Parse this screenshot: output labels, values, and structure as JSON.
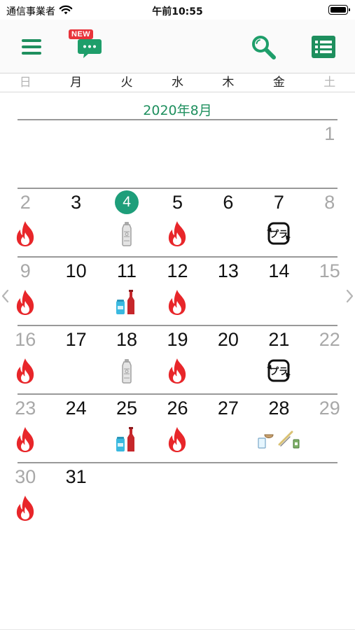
{
  "status_bar": {
    "carrier": "通信事業者",
    "time": "午前10:55"
  },
  "toolbar": {
    "menu_icon": "hamburger-menu-icon",
    "news_badge": "NEW",
    "news_icon": "chat-bubble-icon",
    "search_icon": "search-icon",
    "list_icon": "list-icon",
    "accent_color": "#1e8f5e"
  },
  "weekdays": [
    "日",
    "月",
    "火",
    "水",
    "木",
    "金",
    "土"
  ],
  "month_title": "2020年8月",
  "today": 4,
  "garbage_types": {
    "burnable": "flame-icon",
    "pet_bottle": "pet-bottle-icon",
    "cans_bottles": "can-and-bottle-icon",
    "plastic": "plastic-recycle-icon",
    "small_items": "misc-items-icon"
  },
  "weeks": [
    [
      null,
      null,
      null,
      null,
      null,
      null,
      {
        "day": "1",
        "g": []
      }
    ],
    [
      {
        "day": "2",
        "g": [
          "burnable"
        ]
      },
      {
        "day": "3",
        "g": []
      },
      {
        "day": "4",
        "g": [
          "pet_bottle"
        ]
      },
      {
        "day": "5",
        "g": [
          "burnable"
        ]
      },
      {
        "day": "6",
        "g": []
      },
      {
        "day": "7",
        "g": [
          "plastic"
        ]
      },
      {
        "day": "8",
        "g": []
      }
    ],
    [
      {
        "day": "9",
        "g": [
          "burnable"
        ]
      },
      {
        "day": "10",
        "g": []
      },
      {
        "day": "11",
        "g": [
          "cans_bottles"
        ]
      },
      {
        "day": "12",
        "g": [
          "burnable"
        ]
      },
      {
        "day": "13",
        "g": []
      },
      {
        "day": "14",
        "g": []
      },
      {
        "day": "15",
        "g": []
      }
    ],
    [
      {
        "day": "16",
        "g": [
          "burnable"
        ]
      },
      {
        "day": "17",
        "g": []
      },
      {
        "day": "18",
        "g": [
          "pet_bottle"
        ]
      },
      {
        "day": "19",
        "g": [
          "burnable"
        ]
      },
      {
        "day": "20",
        "g": []
      },
      {
        "day": "21",
        "g": [
          "plastic"
        ]
      },
      {
        "day": "22",
        "g": []
      }
    ],
    [
      {
        "day": "23",
        "g": [
          "burnable"
        ]
      },
      {
        "day": "24",
        "g": []
      },
      {
        "day": "25",
        "g": [
          "cans_bottles"
        ]
      },
      {
        "day": "26",
        "g": [
          "burnable"
        ]
      },
      {
        "day": "27",
        "g": []
      },
      {
        "day": "28",
        "g": [
          "small_items"
        ]
      },
      {
        "day": "29",
        "g": []
      }
    ],
    [
      {
        "day": "30",
        "g": [
          "burnable"
        ]
      },
      {
        "day": "31",
        "g": []
      },
      null,
      null,
      null,
      null,
      null
    ]
  ],
  "nav": {
    "prev_icon": "chevron-left-icon",
    "next_icon": "chevron-right-icon"
  }
}
